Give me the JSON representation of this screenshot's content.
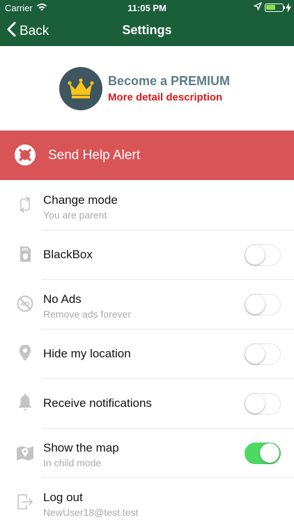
{
  "status_bar": {
    "carrier": "Carrier",
    "time": "11:05 PM",
    "battery_level": 0.55,
    "icons": [
      "wifi-icon",
      "location-arrow-icon",
      "battery-icon",
      "charging-bolt-icon"
    ]
  },
  "nav": {
    "back_label": "Back",
    "title": "Settings"
  },
  "premium": {
    "title": "Become a PREMIUM",
    "description": "More detail description",
    "icon": "crown-icon"
  },
  "help_alert": {
    "label": "Send Help Alert",
    "icon": "lifebuoy-icon"
  },
  "rows": [
    {
      "label": "Change mode",
      "sub": "You are parent",
      "icon": "switch-arrows-icon"
    },
    {
      "label": "BlackBox",
      "sub": "",
      "icon": "sd-card-icon",
      "toggle": false
    },
    {
      "label": "No Ads",
      "sub": "Remove ads forever",
      "icon": "no-ads-icon",
      "toggle": false
    },
    {
      "label": "Hide my location",
      "sub": "",
      "icon": "location-pin-icon",
      "toggle": false
    },
    {
      "label": "Receive notifications",
      "sub": "",
      "icon": "bell-icon",
      "toggle": false
    },
    {
      "label": "Show the map",
      "sub": "In child mode",
      "icon": "map-icon",
      "toggle": true
    },
    {
      "label": "Log out",
      "sub": "NewUser18@test.test",
      "icon": "logout-icon"
    }
  ],
  "colors": {
    "header": "#1b5e3a",
    "help_alert": "#d95457",
    "premium_title": "#5d7a88",
    "premium_desc": "#e01818",
    "toggle_on": "#4cd964"
  }
}
